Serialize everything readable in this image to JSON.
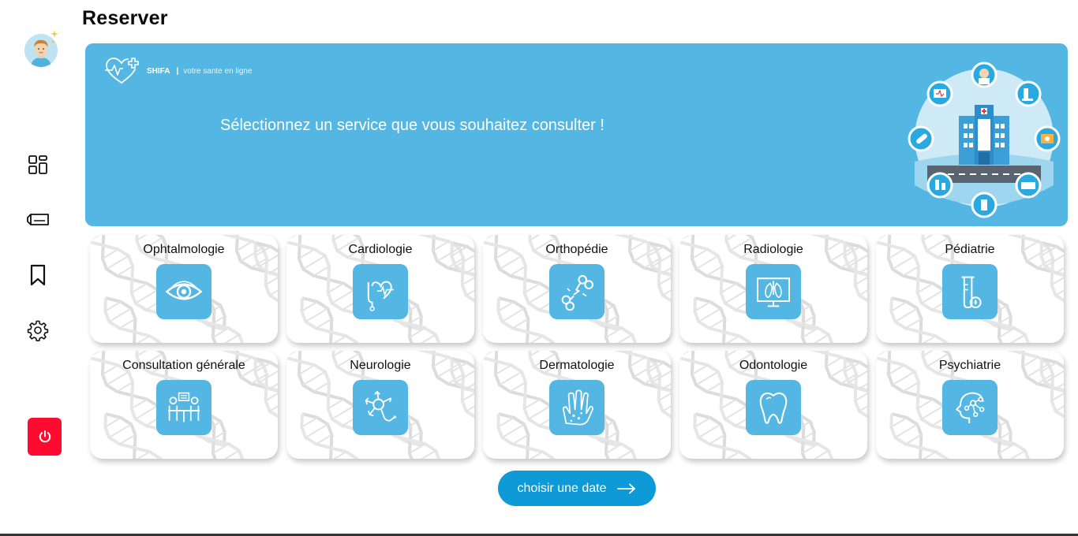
{
  "page": {
    "title": "Reserver"
  },
  "sidebar": {
    "items": [
      {
        "name": "dashboard",
        "icon": "dashboard-icon"
      },
      {
        "name": "tickets",
        "icon": "ticket-icon"
      },
      {
        "name": "bookmarks",
        "icon": "bookmark-icon"
      },
      {
        "name": "settings",
        "icon": "gear-icon"
      }
    ],
    "logout_icon": "power-icon",
    "logout_color": "#ff0b2f"
  },
  "banner": {
    "brand": "SHIFA",
    "separator": "|",
    "tagline": "votre sante en ligne",
    "message": "Sélectionnez un service que vous souhaitez consulter !",
    "background": "#53b6e3"
  },
  "services": [
    {
      "label": "Ophtalmologie",
      "icon": "eye-icon"
    },
    {
      "label": "Cardiologie",
      "icon": "heart-stethoscope-icon"
    },
    {
      "label": "Orthopédie",
      "icon": "broken-bone-icon"
    },
    {
      "label": "Radiologie",
      "icon": "xray-monitor-icon"
    },
    {
      "label": "Pédiatrie",
      "icon": "test-tube-icon"
    },
    {
      "label": "Consultation générale",
      "icon": "consultation-icon"
    },
    {
      "label": "Neurologie",
      "icon": "neuron-icon"
    },
    {
      "label": "Dermatologie",
      "icon": "skin-hand-icon"
    },
    {
      "label": "Odontologie",
      "icon": "tooth-icon"
    },
    {
      "label": "Psychiatrie",
      "icon": "mind-icon"
    }
  ],
  "cta": {
    "label": "choisir une date",
    "icon": "arrow-right-icon",
    "color": "#0d9ad6"
  },
  "accent": "#53b6e3"
}
